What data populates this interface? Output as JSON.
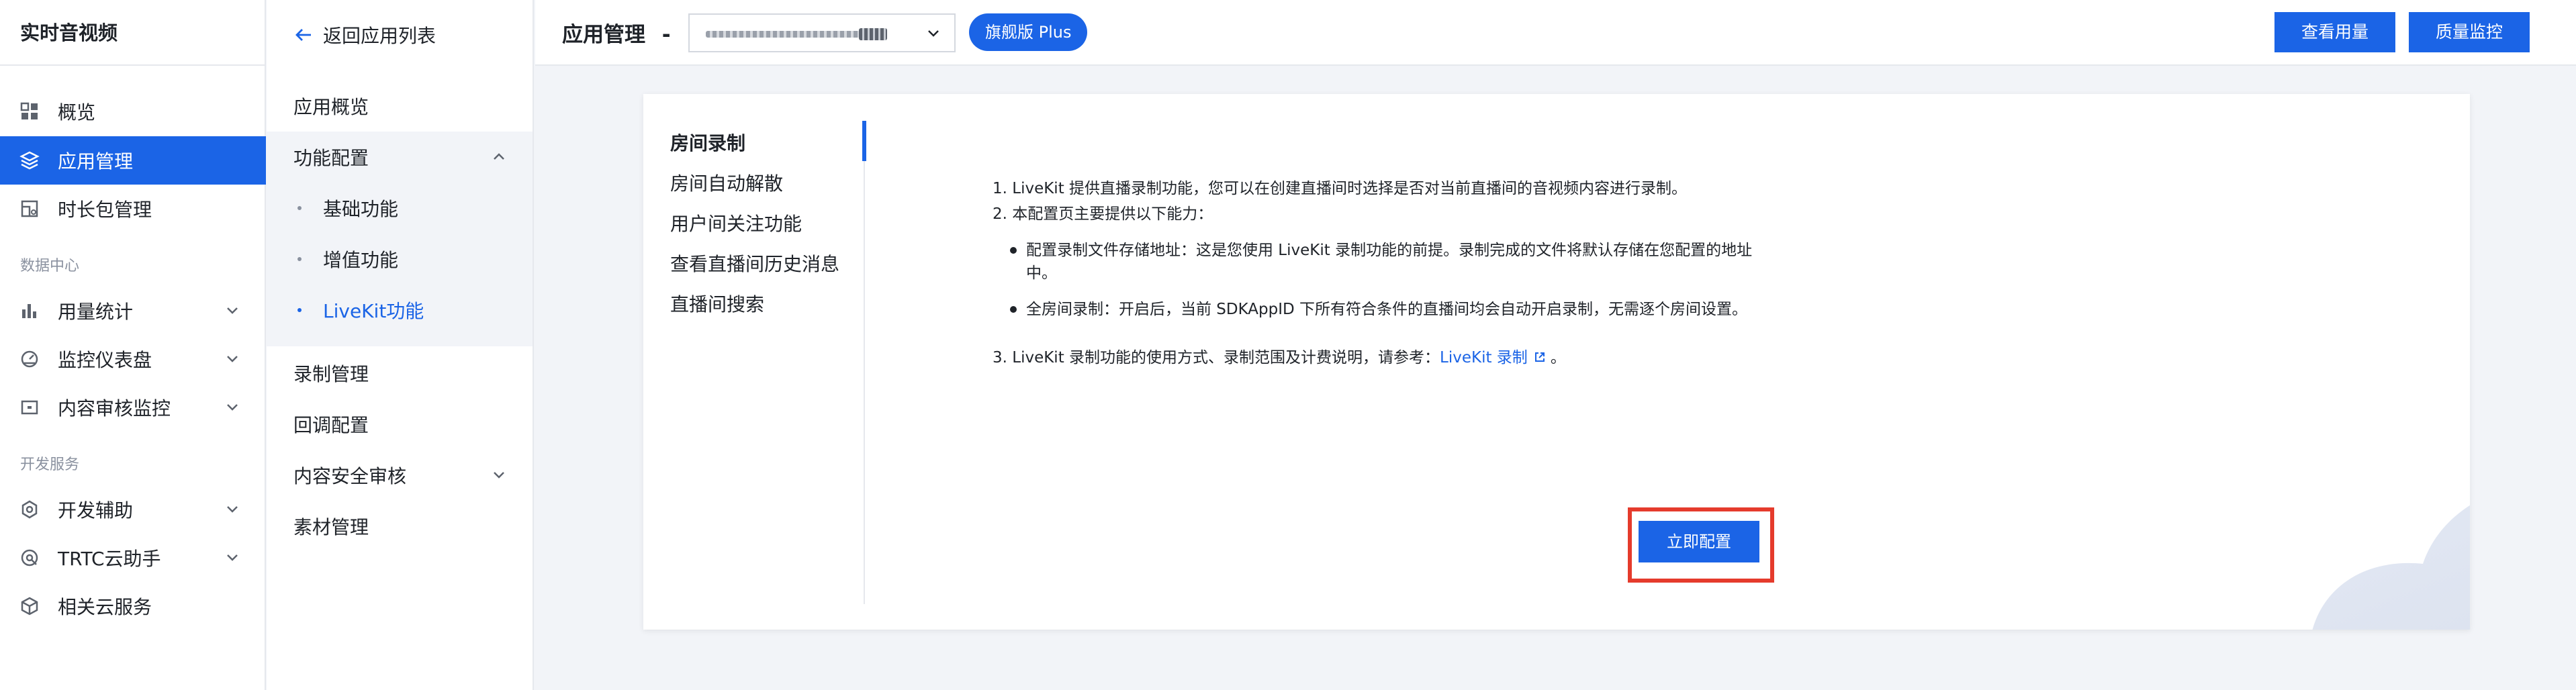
{
  "sidebar": {
    "title": "实时音视频",
    "items": [
      {
        "label": "概览"
      },
      {
        "label": "应用管理"
      },
      {
        "label": "时长包管理"
      }
    ],
    "section_data": "数据中心",
    "data_items": [
      {
        "label": "用量统计"
      },
      {
        "label": "监控仪表盘"
      },
      {
        "label": "内容审核监控"
      }
    ],
    "section_dev": "开发服务",
    "dev_items": [
      {
        "label": "开发辅助"
      },
      {
        "label": "TRTC云助手"
      },
      {
        "label": "相关云服务"
      }
    ]
  },
  "subnav": {
    "back": "返回应用列表",
    "overview": "应用概览",
    "feature_config": "功能配置",
    "children": [
      {
        "label": "基础功能"
      },
      {
        "label": "增值功能"
      },
      {
        "label": "LiveKit功能"
      }
    ],
    "record": "录制管理",
    "callback": "回调配置",
    "content_audit": "内容安全审核",
    "material": "素材管理"
  },
  "header": {
    "title": "应用管理",
    "dash": "-",
    "badge": "旗舰版 Plus",
    "btn_usage": "查看用量",
    "btn_quality": "质量监控"
  },
  "tabs": [
    {
      "label": "房间录制"
    },
    {
      "label": "房间自动解散"
    },
    {
      "label": "用户间关注功能"
    },
    {
      "label": "查看直播间历史消息"
    },
    {
      "label": "直播间搜索"
    }
  ],
  "content": {
    "p1": "1. LiveKit 提供直播录制功能，您可以在创建直播间时选择是否对当前直播间的音视频内容进行录制。",
    "p2": "2. 本配置页主要提供以下能力：",
    "b1_line1": "配置录制文件存储地址：这是您使用 LiveKit 录制功能的前提。录制完成的文件将默认存储在您配置的地址",
    "b1_line2": "中。",
    "b2": "全房间录制：开启后，当前 SDKAppID 下所有符合条件的直播间均会自动开启录制，无需逐个房间设置。",
    "p3_prefix": "3. LiveKit 录制功能的使用方式、录制范围及计费说明，请参考：",
    "p3_link": "LiveKit 录制",
    "p3_suffix": "。",
    "cta": "立即配置"
  },
  "colors": {
    "accent": "#1b64e6",
    "highlight": "#e53b2c"
  }
}
